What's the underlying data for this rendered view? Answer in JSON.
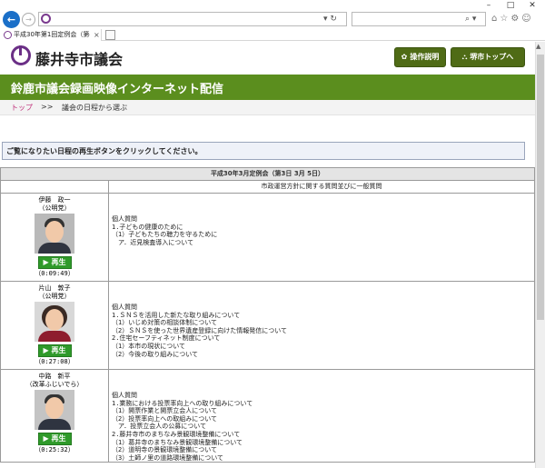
{
  "browser": {
    "window_controls": [
      "–",
      "□",
      "✕"
    ],
    "url_icons": "▾ ↻",
    "search_icons": "⌕ ▾",
    "tab_title": "平成30年第1回定例会（第4...",
    "tab_close": "×"
  },
  "header": {
    "site_name": "藤井寺市議会",
    "help_button": "操作説明",
    "top_button": "市トップへ",
    "top_button_prefix": "堺"
  },
  "banner": {
    "title": "鈴鹿市議会録画映像インターネット配信"
  },
  "breadcrumb": {
    "top": "トップ",
    "separator": ">>",
    "current": "議会の日程から選ぶ"
  },
  "notice": "ご覧になりたい日程の再生ボタンをクリックしてください。",
  "session": {
    "title": "平成30年3月定例会（第3日 3月 5日）",
    "subtitle": "市政運営方針に関する質問並びに一般質問",
    "play_label": "再生",
    "speakers": [
      {
        "name": "伊藤　政一",
        "party": "（公明党）",
        "duration": "（0:09:49）",
        "lines": [
          "個人質問",
          "1.子どもの健康のために",
          "（1）子どもたちの聴力を守るために",
          "　ア．近見検査導入について"
        ]
      },
      {
        "name": "片山　敦子",
        "party": "（公明党）",
        "duration": "（0:27:08）",
        "lines": [
          "個人質問",
          "1.ＳＮＳを活用した新たな取り組みについて",
          "（1）いじめ対策の相談体制について",
          "（2）ＳＮＳを使った世界遺産登録に向けた情報発信について",
          "2.住宅セーフティネット制度について",
          "（1）本市の現状について",
          "（2）今後の取り組みについて"
        ]
      },
      {
        "name": "中路　新平",
        "party": "（改革ふじいでら）",
        "duration": "（0:25:32）",
        "lines": [
          "個人質問",
          "1.業務における投票率向上への取り組みについて",
          "（1）開票作業と開票立会人について",
          "（2）投票率向上への取組みについて",
          "　ア．投票立会人の公募について",
          "2.藤井寺市のまちなみ景観環境整備について",
          "（1）葛井寺のまちなみ景観環境整備について",
          "（2）道明寺の景観環境整備について",
          "（3）土師ノ里の道路環境整備について"
        ]
      }
    ]
  }
}
